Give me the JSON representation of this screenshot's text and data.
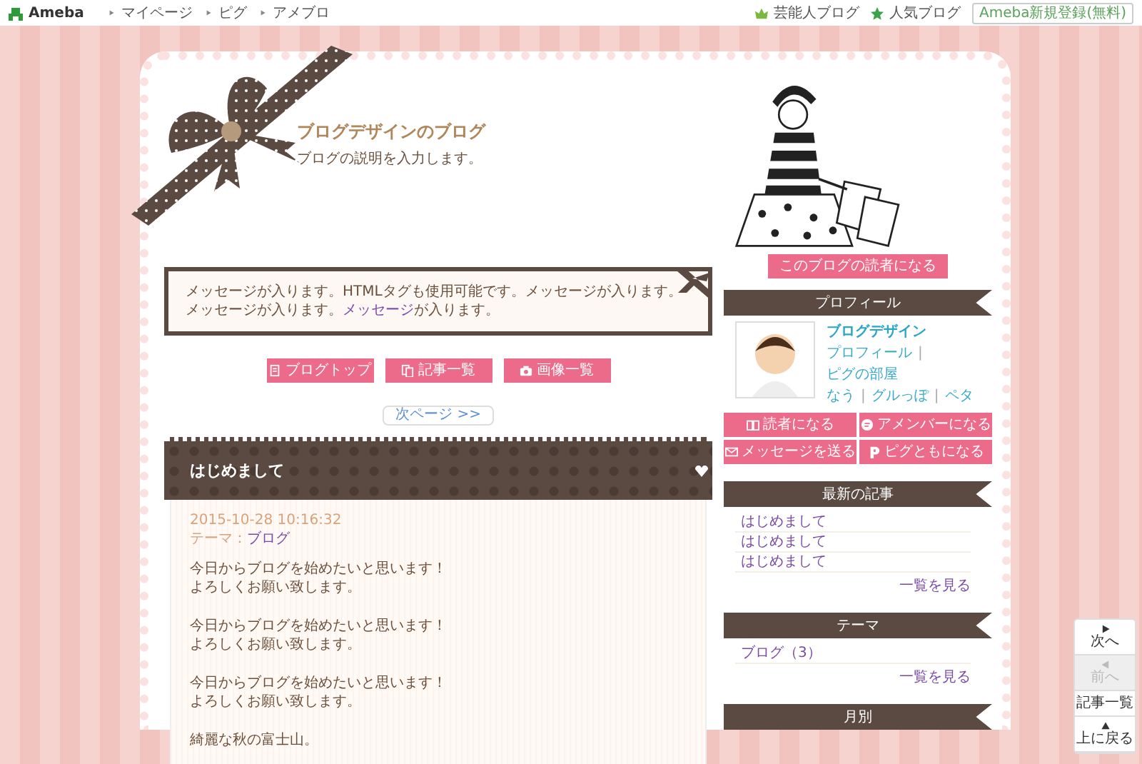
{
  "top_bar": {
    "logo": "Ameba",
    "links": [
      "マイページ",
      "ピグ",
      "アメブロ"
    ],
    "right_links": [
      {
        "label": "芸能人ブログ",
        "kind": "crown"
      },
      {
        "label": "人気ブログ",
        "kind": "star"
      }
    ],
    "signup": "Ameba新規登録(無料)"
  },
  "blog": {
    "title": "ブログデザインのブログ",
    "description": "ブログの説明を入力します。"
  },
  "message": {
    "text": "メッセージが入ります。HTMLタグも使用可能です。メッセージが入ります。メッセージが入ります。",
    "link": "メッセージ",
    "tail": "が入ります。"
  },
  "nav_buttons": [
    "ブログトップ",
    "記事一覧",
    "画像一覧"
  ],
  "pager": "次ページ >>",
  "entry": {
    "title": "はじめまして",
    "datetime": "2015-10-28 10:16:32",
    "theme_label": "テーマ：",
    "theme": "ブログ",
    "paragraphs": [
      [
        "今日からブログを始めたいと思います！",
        "よろしくお願い致します。"
      ],
      [
        "今日からブログを始めたいと思います！",
        "よろしくお願い致します。"
      ],
      [
        "今日からブログを始めたいと思います！",
        "よろしくお願い致します。"
      ],
      [
        "綺麗な秋の富士山。"
      ]
    ]
  },
  "reader_button": "このブログの読者になる",
  "profile": {
    "heading": "プロフィール",
    "name": "ブログデザイン",
    "separator": "|",
    "links": [
      [
        "プロフィール",
        "ピグの部屋"
      ],
      [
        "なう",
        "グルっぽ",
        "ペタ"
      ]
    ]
  },
  "profile_buttons": [
    "読者になる",
    "アメンバーになる",
    "メッセージを送る",
    "ピグともになる"
  ],
  "recent": {
    "heading": "最新の記事",
    "items": [
      "はじめまして",
      "はじめまして",
      "はじめまして"
    ],
    "more": "一覧を見る"
  },
  "themes": {
    "heading": "テーマ",
    "items": [
      "ブログ（3）"
    ],
    "more": "一覧を見る"
  },
  "monthly": {
    "heading": "月別"
  },
  "side_nav": [
    {
      "label": "次へ",
      "disabled": false
    },
    {
      "label": "前へ",
      "disabled": true
    },
    {
      "label": "記事一覧",
      "disabled": false
    },
    {
      "label": "上に戻る",
      "disabled": false
    }
  ]
}
